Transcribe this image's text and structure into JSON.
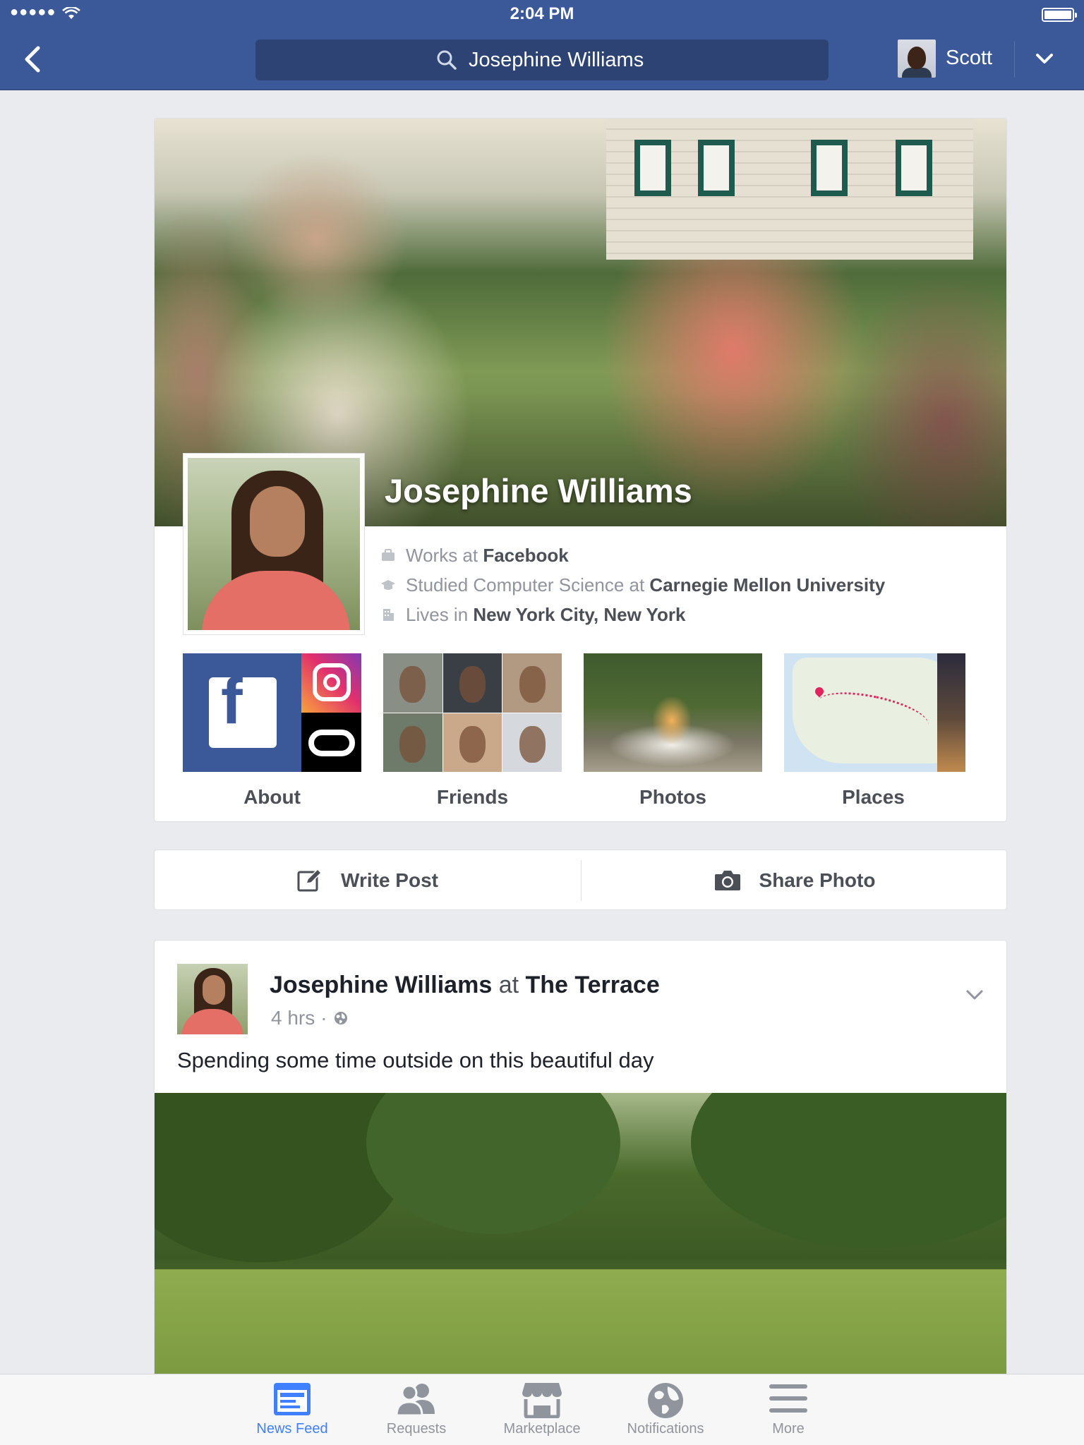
{
  "status_bar": {
    "time": "2:04 PM"
  },
  "header": {
    "search_query": "Josephine Williams",
    "user_name": "Scott"
  },
  "profile": {
    "name": "Josephine Williams",
    "work": {
      "prefix": "Works at ",
      "value": "Facebook"
    },
    "education": {
      "prefix": "Studied Computer Science at ",
      "value": "Carnegie Mellon University"
    },
    "location": {
      "prefix": "Lives in ",
      "value": "New York City, New York"
    },
    "tiles": [
      {
        "label": "About"
      },
      {
        "label": "Friends"
      },
      {
        "label": "Photos"
      },
      {
        "label": "Places"
      }
    ]
  },
  "actions": {
    "write_post": "Write Post",
    "share_photo": "Share Photo"
  },
  "post": {
    "author": "Josephine Williams",
    "at_word": "at",
    "place": "The Terrace",
    "time": "4 hrs",
    "separator": "·",
    "privacy_icon": "globe-icon",
    "text": "Spending some time outside on this beautiful day"
  },
  "tabbar": {
    "active_color": "#4080ff",
    "items": [
      {
        "label": "News Feed",
        "icon": "news-feed-icon",
        "active": true
      },
      {
        "label": "Requests",
        "icon": "friend-requests-icon",
        "active": false
      },
      {
        "label": "Marketplace",
        "icon": "marketplace-icon",
        "active": false
      },
      {
        "label": "Notifications",
        "icon": "notifications-globe-icon",
        "active": false
      },
      {
        "label": "More",
        "icon": "menu-icon",
        "active": false
      }
    ]
  },
  "colors": {
    "brand": "#3b5998",
    "search_bg": "#2d4373",
    "page_bg": "#e9ebee"
  }
}
